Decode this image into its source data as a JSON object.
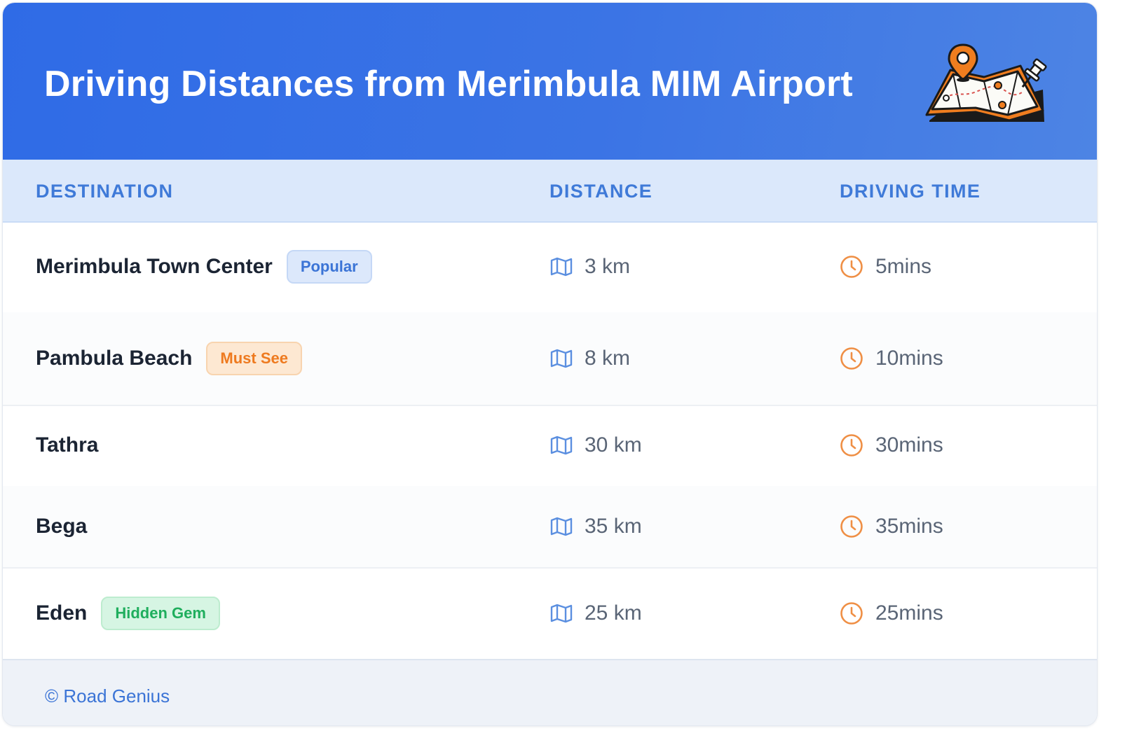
{
  "header": {
    "title": "Driving Distances from Merimbula MIM Airport",
    "illustration_icon": "map-with-pins-icon"
  },
  "columns": {
    "destination": "DESTINATION",
    "distance": "DISTANCE",
    "driving_time": "DRIVING TIME"
  },
  "rows": [
    {
      "destination": "Merimbula Town Center",
      "badge": "Popular",
      "badge_type": "popular",
      "distance": "3 km",
      "time": "5mins"
    },
    {
      "destination": "Pambula Beach",
      "badge": "Must See",
      "badge_type": "mustsee",
      "distance": "8 km",
      "time": "10mins"
    },
    {
      "destination": "Tathra",
      "badge": "",
      "badge_type": "",
      "distance": "30 km",
      "time": "30mins"
    },
    {
      "destination": "Bega",
      "badge": "",
      "badge_type": "",
      "distance": "35 km",
      "time": "35mins"
    },
    {
      "destination": "Eden",
      "badge": "Hidden Gem",
      "badge_type": "hidden",
      "distance": "25 km",
      "time": "25mins"
    }
  ],
  "icons": {
    "distance": "map-icon",
    "time": "clock-icon"
  },
  "footer": {
    "credit": "© Road Genius"
  },
  "colors": {
    "header_gradient_start": "#2f6be6",
    "header_gradient_end": "#4d84e4",
    "column_header_bg": "#dbe8fb",
    "column_header_text": "#3f7ad8",
    "map_icon": "#5b8fe0",
    "clock_icon": "#ef8f45",
    "badge_popular": "#3b74d6",
    "badge_must_see": "#ee7a1f",
    "badge_hidden_gem": "#1fae5d",
    "footer_text": "#3b74d6"
  }
}
